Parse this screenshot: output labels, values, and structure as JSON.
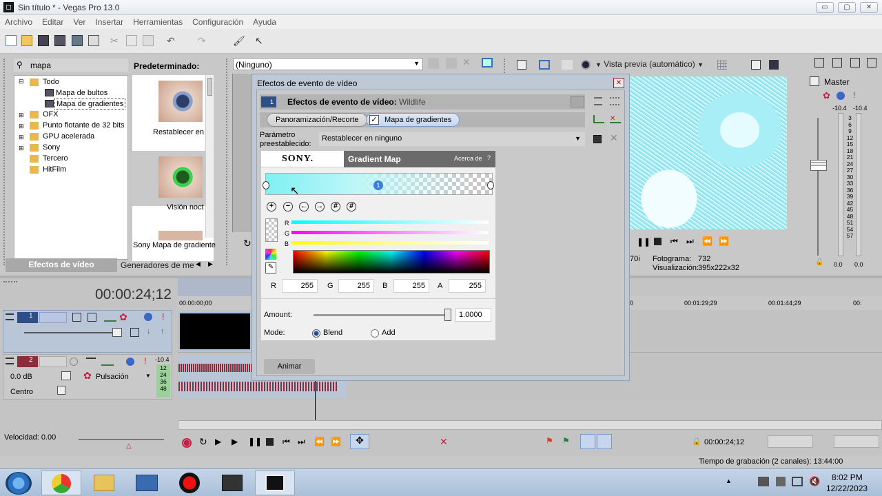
{
  "window": {
    "title": "Sin título * - Vegas Pro 13.0",
    "minimize": "▭",
    "maximize": "▢",
    "close": "✕"
  },
  "menu": [
    "Archivo",
    "Editar",
    "Ver",
    "Insertar",
    "Herramientas",
    "Configuración",
    "Ayuda"
  ],
  "explorer": {
    "search_value": "mapa",
    "tree": [
      "Todo",
      "Mapa de bultos",
      "Mapa de gradientes",
      "OFX",
      "Punto flotante de 32 bits",
      "GPU acelerada",
      "Sony",
      "Tercero",
      "HitFilm"
    ],
    "preset_header": "Predeterminado:",
    "presets": [
      "Restablecer en",
      "Visión noct",
      "Sony Mapa de gradiente"
    ],
    "tabs": [
      "Efectos de vídeo",
      "Generadores de medi"
    ]
  },
  "trimmer": {
    "dropdown": "(Ninguno)"
  },
  "preview": {
    "mode": "Vista previa (automático)",
    "frame_label": "Fotograma:",
    "frame_value": "732",
    "display_label": "Visualización:",
    "display_value": "395x222x32",
    "left_value": "70i"
  },
  "master": {
    "title": "Master",
    "left_db": "-10.4",
    "right_db": "-10.4",
    "scale": [
      "3",
      "6",
      "9",
      "12",
      "15",
      "18",
      "21",
      "24",
      "27",
      "30",
      "33",
      "36",
      "39",
      "42",
      "45",
      "48",
      "51",
      "54",
      "57"
    ],
    "bottom_left": "0.0",
    "bottom_right": "0.0"
  },
  "dialog": {
    "title": "Efectos de evento de vídeo",
    "header_label": "Efectos de evento de vídeo:",
    "header_clip": "Wildlife",
    "chain": [
      "Panoramización/Recorte",
      "Mapa de gradientes"
    ],
    "preset_label_line1": "Parámetro",
    "preset_label_line2": "preestablecido:",
    "preset_value": "Restablecer en ninguno",
    "plugin": {
      "brand": "SONY.",
      "name": "Gradient Map",
      "about": "Acerca de",
      "help": "?"
    },
    "stop_index": "1",
    "channels": [
      "R",
      "G",
      "B"
    ],
    "rgba": {
      "r_label": "R",
      "r": "255",
      "g_label": "G",
      "g": "255",
      "b_label": "B",
      "b": "255",
      "a_label": "A",
      "a": "255"
    },
    "amount_label": "Amount:",
    "amount_value": "1.0000",
    "amount_fraction": 1.0,
    "mode_label": "Mode:",
    "mode_options": [
      "Blend",
      "Add"
    ],
    "mode_selected": "Blend",
    "animate": "Animar"
  },
  "timeline": {
    "timecode": "00:00:24;12",
    "ruler": [
      "00:00:00;00",
      "0",
      "00:01:29;29",
      "00:01:44;29",
      "00:"
    ],
    "track1_num": "1",
    "track2_num": "2",
    "track2_db": "-10.4",
    "track2_meter": [
      "12",
      "24",
      "36",
      "48"
    ],
    "volume": "0.0 dB",
    "pan": "Centro",
    "fx": "Pulsación",
    "speed": "Velocidad: 0.00",
    "transport_time": "00:00:24;12",
    "status": "Tiempo de grabación (2 canales): 13:44:00"
  },
  "taskbar": {
    "time": "8:02 PM",
    "date": "12/22/2023"
  },
  "colors": {
    "accent": "#3b7fd8",
    "teal": "#9eeaf2",
    "wave": "#8b2d3a"
  }
}
